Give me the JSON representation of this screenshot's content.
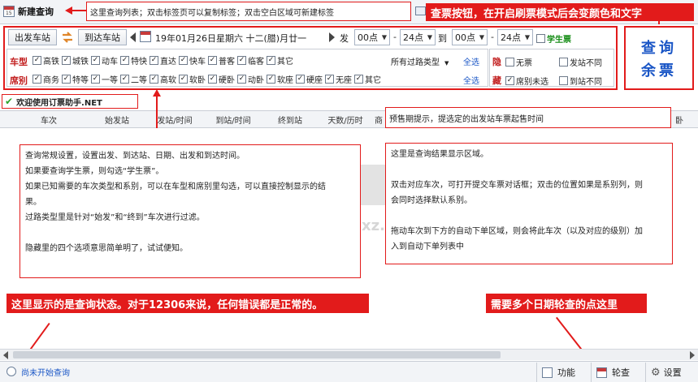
{
  "tabs": {
    "new_query_label": "新建查询",
    "list_hint": "这里查询列表；双击标签页可以复制标签；双击空白区域可新建标签"
  },
  "query_button_hint": "查票按钮，在开启刷票模式后会变颜色和文字",
  "query_button_label": [
    "查询",
    "余票"
  ],
  "query": {
    "from_label": "出发车站",
    "to_label": "到达车站",
    "date": "19年01月26日星期六 十二(腊)月廿一",
    "depart_label": "发",
    "from_time": "00点",
    "to_time": "24点",
    "to_word": "到",
    "arr_from": "00点",
    "arr_to": "24点",
    "student_label": "学生票"
  },
  "train_types": {
    "label": "车型",
    "items": [
      "高铁",
      "城铁",
      "动车",
      "特快",
      "直达",
      "快车",
      "普客",
      "临客",
      "其它"
    ],
    "passing_select": "所有过路类型",
    "all_label": "全选"
  },
  "seats": {
    "label": "席别",
    "items": [
      "商务",
      "特等",
      "一等",
      "二等",
      "高软",
      "软卧",
      "硬卧",
      "动卧",
      "软座",
      "硬座",
      "无座",
      "其它"
    ],
    "all_label": "全选"
  },
  "hidden_opts": {
    "hide_label": "隐",
    "no_ticket": "无票",
    "diff_from": "发站不同",
    "hidden_label": "藏",
    "seat_unselected": "席别未选",
    "diff_to": "到站不同"
  },
  "welcome": "欢迎使用订票助手.NET",
  "columns": [
    "车次",
    "始发站",
    "发站/时间",
    "到站/时间",
    "终到站",
    "天数/历时",
    "商",
    "卧"
  ],
  "presale_hint": "预售期提示，提选定的出发站车票起售时间",
  "left_note": [
    "查询常规设置，设置出发、到达站、日期、出发和到达时间。",
    "如果要查询学生票，则勾选“学生票”。",
    "如果已知需要的车次类型和系别，可以在车型和席别里勾选，可以直接控制显示的结",
    "果。",
    "过路类型里是针对“始发”和“终到”车次进行过滤。",
    "",
    "隐藏里的四个选项意思简单明了，试试便知。"
  ],
  "right_note": [
    "这里是查询结果显示区域。",
    "",
    "双击对应车次，可打开提交车票对话框；双击的位置如果是系别列，则",
    "会同时选择默认系别。",
    "",
    "拖动车次到下方的自动下单区域，则会将此车次（以及对应的级别）加",
    "入到自动下单列表中"
  ],
  "status_note": "这里显示的是查询状态。对于12306来说，任何错误都是正常的。",
  "multi_date_note": "需要多个日期轮查的点这里",
  "status_text": "尚未开始查询",
  "toolbar": {
    "function_label": "功能",
    "rotate_label": "轮查",
    "settings_label": "设置"
  },
  "watermark": "anxz.com",
  "colors": {
    "accent_red": "#e21b1b",
    "link_blue": "#1a56c6",
    "green_text": "#118a11"
  }
}
